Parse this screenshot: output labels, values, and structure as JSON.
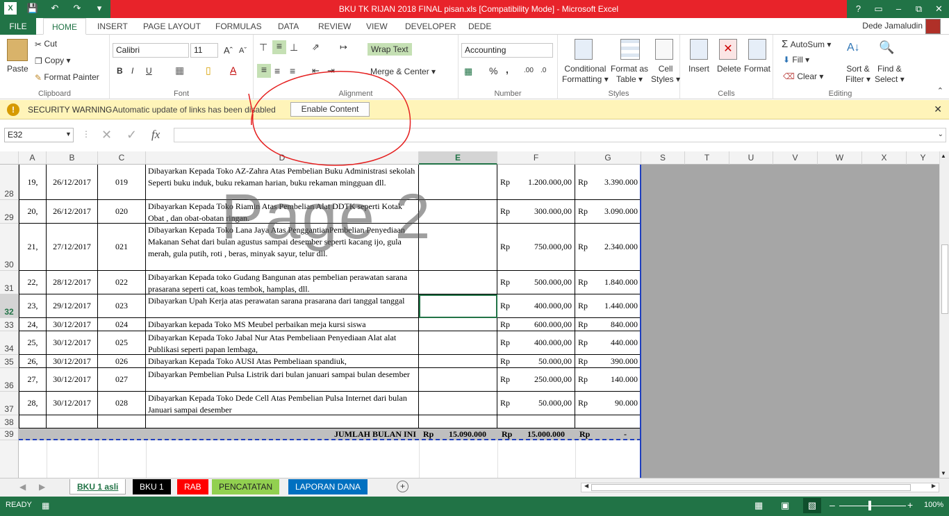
{
  "app": {
    "title": "BKU TK RIJAN 2018 FINAL pisan.xls  [Compatibility Mode] -  Microsoft Excel",
    "user": "Dede Jamaludin"
  },
  "tabs": [
    "FILE",
    "HOME",
    "INSERT",
    "PAGE LAYOUT",
    "FORMULAS",
    "DATA",
    "REVIEW",
    "VIEW",
    "DEVELOPER",
    "DEDE"
  ],
  "ribbon": {
    "clipboard": {
      "paste": "Paste",
      "cut": "Cut",
      "copy": "Copy",
      "format_painter": "Format Painter",
      "label": "Clipboard"
    },
    "font": {
      "name": "Calibri",
      "size": "11",
      "label": "Font",
      "bold": "B",
      "italic": "I",
      "underline": "U"
    },
    "alignment": {
      "wrap": "Wrap Text",
      "merge": "Merge & Center",
      "label": "Alignment"
    },
    "number": {
      "format": "Accounting",
      "label": "Number",
      "percent": "%",
      "comma": ","
    },
    "styles": {
      "cond": [
        "Conditional",
        "Formatting"
      ],
      "table": [
        "Format as",
        "Table"
      ],
      "cell": [
        "Cell",
        "Styles"
      ],
      "label": "Styles"
    },
    "cells": {
      "insert": "Insert",
      "delete": "Delete",
      "format": "Format",
      "label": "Cells"
    },
    "editing": {
      "autosum": "AutoSum",
      "fill": "Fill",
      "clear": "Clear",
      "sort": [
        "Sort &",
        "Filter"
      ],
      "find": [
        "Find &",
        "Select"
      ],
      "label": "Editing"
    }
  },
  "warning": {
    "title": "SECURITY WARNING",
    "message": "Automatic update of links has been disabled",
    "button": "Enable Content"
  },
  "formula": {
    "namebox": "E32",
    "fx": "fx",
    "value": ""
  },
  "columns": [
    "A",
    "B",
    "C",
    "D",
    "E",
    "F",
    "G",
    "S",
    "T",
    "U",
    "V",
    "W",
    "X",
    "Y"
  ],
  "watermark": "Page 2",
  "rows": [
    {
      "n": "28",
      "a": "19,",
      "b": "26/12/2017",
      "c": "019",
      "d": "Dibayarkan Kepada Toko AZ-Zahra  Atas Pembelian Buku Administrasi sekolah Seperti buku induk, buku rekaman harian, buku rekaman mingguan dll.",
      "e": "",
      "fr": "Rp",
      "f": "1.200.000,00",
      "gr": "Rp",
      "g": "3.390.000"
    },
    {
      "n": "29",
      "a": "20,",
      "b": "26/12/2017",
      "c": "020",
      "d": "Dibayarkan Kepada Toko Riamin Atas Pembelian Alat DDTK seperti Kotak Obat , dan obat-obatan ringan.",
      "e": "",
      "fr": "Rp",
      "f": "300.000,00",
      "gr": "Rp",
      "g": "3.090.000"
    },
    {
      "n": "30",
      "a": "21,",
      "b": "27/12/2017",
      "c": "021",
      "d": "Dibayarkan Kepada Toko Lana Jaya Atas PenggantianPembelian Penyediaan Makanan Sehat dari bulan agustus sampai desember seperti kacang ijo, gula merah, gula putih, roti , beras, minyak sayur, telur dll.",
      "e": "",
      "fr": "Rp",
      "f": "750.000,00",
      "gr": "Rp",
      "g": "2.340.000"
    },
    {
      "n": "31",
      "a": "22,",
      "b": "28/12/2017",
      "c": "022",
      "d": "Dibayarkan Kepada toko Gudang Bangunan atas pembelian perawatan sarana prasarana seperti cat, koas tembok, hamplas, dll.",
      "e": "",
      "fr": "Rp",
      "f": "500.000,00",
      "gr": "Rp",
      "g": "1.840.000"
    },
    {
      "n": "32",
      "a": "23,",
      "b": "29/12/2017",
      "c": "023",
      "d": "Dibayarkan Upah Kerja  atas perawatan sarana prasarana dari tanggal tanggal",
      "e": "",
      "fr": "Rp",
      "f": "400.000,00",
      "gr": "Rp",
      "g": "1.440.000"
    },
    {
      "n": "33",
      "a": "24,",
      "b": "30/12/2017",
      "c": "024",
      "d": "Dibayarkan kepada Toko MS Meubel perbaikan meja kursi siswa",
      "e": "",
      "fr": "Rp",
      "f": "600.000,00",
      "gr": "Rp",
      "g": "840.000"
    },
    {
      "n": "34",
      "a": "25,",
      "b": "30/12/2017",
      "c": "025",
      "d": "Dibayarkan Kepada Toko Jabal Nur  Atas Pembeliaan Penyediaan  Alat alat Publikasi seperti papan lembaga,",
      "e": "",
      "fr": "Rp",
      "f": "400.000,00",
      "gr": "Rp",
      "g": "440.000"
    },
    {
      "n": "35",
      "a": "26,",
      "b": "30/12/2017",
      "c": "026",
      "d": "Dibayarkan Kepada Toko AUSI  Atas Pembeliaan  spandiuk,",
      "e": "",
      "fr": "Rp",
      "f": "50.000,00",
      "gr": "Rp",
      "g": "390.000"
    },
    {
      "n": "36",
      "a": "27,",
      "b": "30/12/2017",
      "c": "027",
      "d": "Dibayarkan  Pembelian Pulsa Listrik  dari bulan januari sampai bulan desember",
      "e": "",
      "fr": "Rp",
      "f": "250.000,00",
      "gr": "Rp",
      "g": "140.000"
    },
    {
      "n": "37",
      "a": "28,",
      "b": "30/12/2017",
      "c": "028",
      "d": "Dibayarkan Kepada Toko Dede Cell Atas Pembelian Pulsa Internet dari bulan Januari sampai desember",
      "e": "",
      "fr": "Rp",
      "f": "50.000,00",
      "gr": "Rp",
      "g": "90.000"
    },
    {
      "n": "38",
      "a": "",
      "b": "",
      "c": "",
      "d": "",
      "e": "",
      "fr": "",
      "f": "",
      "gr": "",
      "g": ""
    }
  ],
  "total": {
    "n": "39",
    "label": "JUMLAH BULAN INI",
    "er": "Rp",
    "e": "15.090.000",
    "fr": "Rp",
    "f": "15.000.000",
    "gr": "Rp",
    "g": "-"
  },
  "sheets": [
    "BKU  1 asli",
    "BKU   1",
    "RAB",
    "PENCATATAN",
    "LAPORAN DANA"
  ],
  "sheet_colors": [
    "#ffffff",
    "#000000",
    "#ff0000",
    "#92d050",
    "#0070c0"
  ],
  "status": {
    "ready": "READY",
    "zoom": "100%"
  }
}
